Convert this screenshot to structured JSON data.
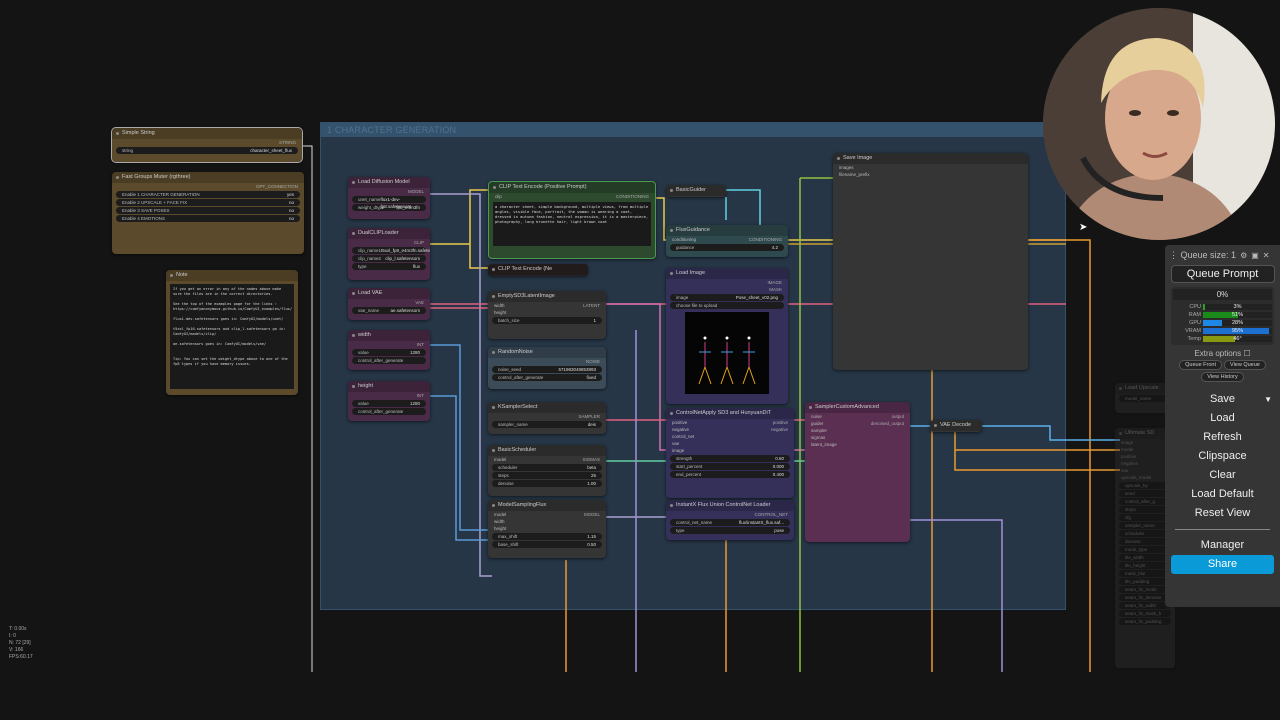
{
  "group": {
    "title": "1 CHARACTER GENERATION"
  },
  "nodes": {
    "simple_string": {
      "title": "Simple String",
      "outputs": [
        "STRING"
      ],
      "widgets": [
        {
          "name": "string",
          "value": "character_sheet_flux"
        }
      ]
    },
    "fast_groups_muter": {
      "title": "Fast Groups Muter (rgthree)",
      "outputs": [
        "OPT_CONNECTION"
      ],
      "widgets": [
        {
          "name": "Enable 1 CHARACTER GENERATION",
          "value": "yes"
        },
        {
          "name": "Enable 2 UPSCALE + FACE FIX",
          "value": "no"
        },
        {
          "name": "Enable 3 SAVE POSES",
          "value": "no"
        },
        {
          "name": "Enable 4 EMOTIONS",
          "value": "no"
        }
      ]
    },
    "note": {
      "title": "Note",
      "text": "If you get an error in any of the nodes above make sure the files are in the correct directories.\n\nSee the top of the examples page for the links :\nhttps://comfyanonymous.github.io/ComfyUI_examples/flux/\n\nflux1-dev.safetensors goes in: ComfyUI/models/unet/\n\nt5xxl_fp16.safetensors and clip_l.safetensors go in: ComfyUI/models/clip/\n\nae.safetensors goes in: ComfyUI/models/vae/\n\n\nTip: You can set the weight_dtype above to one of the fp8 types if you have memory issues."
    },
    "load_diffusion_model": {
      "title": "Load Diffusion Model",
      "outputs": [
        "MODEL"
      ],
      "widgets": [
        {
          "name": "unet_name",
          "value": "flux1-dev-fp8.safetensors"
        },
        {
          "name": "weight_dtype",
          "value": "fp8_e4m3fn"
        }
      ]
    },
    "dual_clip_loader": {
      "title": "DualCLIPLoader",
      "outputs": [
        "CLIP"
      ],
      "widgets": [
        {
          "name": "clip_name1",
          "value": "t5xxl_fp8_e4m3fn.safetensors"
        },
        {
          "name": "clip_name2",
          "value": "clip_l.safetensors"
        },
        {
          "name": "type",
          "value": "flux"
        }
      ]
    },
    "load_vae": {
      "title": "Load VAE",
      "outputs": [
        "VAE"
      ],
      "widgets": [
        {
          "name": "vae_name",
          "value": "ae.safetensors"
        }
      ]
    },
    "width": {
      "title": "width",
      "outputs": [
        "INT"
      ],
      "widgets": [
        {
          "name": "value",
          "value": "1280"
        },
        {
          "name": "control_after_generate",
          "value": ""
        }
      ]
    },
    "height": {
      "title": "height",
      "outputs": [
        "INT"
      ],
      "widgets": [
        {
          "name": "value",
          "value": "1280"
        },
        {
          "name": "control_after_generate",
          "value": ""
        }
      ]
    },
    "clip_positive": {
      "title": "CLIP Text Encode (Positive Prompt)",
      "inputs": [
        "clip"
      ],
      "outputs": [
        "CONDITIONING"
      ],
      "prompt": "a character sheet, simple background, multiple views, from multiple angles, visible face, portrait, the woman is wearing a coat, dressed in autumn fashion, neutral expression, it is a masterpiece, photography, long brunette hair, light brown coat"
    },
    "clip_negative": {
      "title": "CLIP Text Encode (Ne"
    },
    "empty_latent": {
      "title": "EmptySD3LatentImage",
      "inputs": [
        "width",
        "height"
      ],
      "outputs": [
        "LATENT"
      ],
      "widgets": [
        {
          "name": "batch_size",
          "value": "1"
        }
      ]
    },
    "random_noise": {
      "title": "RandomNoise",
      "outputs": [
        "NOISE"
      ],
      "widgets": [
        {
          "name": "noise_seed",
          "value": "571983048853893"
        },
        {
          "name": "control_after_generate",
          "value": "fixed"
        }
      ]
    },
    "ksampler_select": {
      "title": "KSamplerSelect",
      "outputs": [
        "SAMPLER"
      ],
      "widgets": [
        {
          "name": "sampler_name",
          "value": "deis"
        }
      ]
    },
    "basic_scheduler": {
      "title": "BasicScheduler",
      "inputs": [
        "model"
      ],
      "outputs": [
        "SIGMAS"
      ],
      "widgets": [
        {
          "name": "scheduler",
          "value": "beta"
        },
        {
          "name": "steps",
          "value": "25"
        },
        {
          "name": "denoise",
          "value": "1.00"
        }
      ]
    },
    "model_sampling_flux": {
      "title": "ModelSamplingFlux",
      "inputs": [
        "model",
        "width",
        "height"
      ],
      "outputs": [
        "MODEL"
      ],
      "widgets": [
        {
          "name": "max_shift",
          "value": "1.15"
        },
        {
          "name": "base_shift",
          "value": "0.50"
        }
      ]
    },
    "basic_guider": {
      "title": "BasicGuider"
    },
    "flux_guidance": {
      "title": "FluxGuidance",
      "inputs": [
        "conditioning"
      ],
      "outputs": [
        "CONDITIONING"
      ],
      "widgets": [
        {
          "name": "guidance",
          "value": "4.2"
        }
      ]
    },
    "load_image": {
      "title": "Load Image",
      "outputs": [
        "IMAGE",
        "MASK"
      ],
      "widgets": [
        {
          "name": "image",
          "value": "Pose_sheet_v02.png"
        }
      ],
      "upload_label": "choose file to upload"
    },
    "controlnet_apply": {
      "title": "ControlNetApply SD3 and HunyuanDiT",
      "inputs": [
        "positive",
        "negative",
        "control_net",
        "vae",
        "image"
      ],
      "outputs": [
        "positive",
        "negative"
      ],
      "widgets": [
        {
          "name": "strength",
          "value": "0.60"
        },
        {
          "name": "start_percent",
          "value": "0.000"
        },
        {
          "name": "end_percent",
          "value": "0.400"
        }
      ]
    },
    "controlnet_loader": {
      "title": "InstantX Flux Union ControlNet Loader",
      "outputs": [
        "CONTROL_NET"
      ],
      "widgets": [
        {
          "name": "control_net_name",
          "value": "flux\\instantX_flux.saf..."
        },
        {
          "name": "type",
          "value": "pose"
        }
      ]
    },
    "sampler_custom_advanced": {
      "title": "SamplerCustomAdvanced",
      "inputs": [
        "noise",
        "guider",
        "sampler",
        "sigmas",
        "latent_image"
      ],
      "outputs": [
        "output",
        "denoised_output"
      ]
    },
    "vae_decode": {
      "title": "VAE Decode"
    },
    "save_image": {
      "title": "Save Image",
      "inputs": [
        "images",
        "filename_prefix"
      ]
    },
    "load_upscale": {
      "title": "Load Upscale",
      "widgets": [
        {
          "name": "model_name",
          "value": ""
        }
      ]
    },
    "ultimate_sd": {
      "title": "Ultimate SD",
      "inputs": [
        "image",
        "model",
        "positive",
        "negative",
        "vae",
        "upscale_model"
      ],
      "widgets": [
        {
          "name": "upscale_by",
          "value": ""
        },
        {
          "name": "seed",
          "value": ""
        },
        {
          "name": "control_after_g",
          "value": ""
        },
        {
          "name": "steps",
          "value": ""
        },
        {
          "name": "cfg",
          "value": ""
        },
        {
          "name": "sampler_name",
          "value": ""
        },
        {
          "name": "scheduler",
          "value": ""
        },
        {
          "name": "denoise",
          "value": ""
        },
        {
          "name": "mode_type",
          "value": ""
        },
        {
          "name": "tile_width",
          "value": ""
        },
        {
          "name": "tile_height",
          "value": ""
        },
        {
          "name": "mask_blur",
          "value": ""
        },
        {
          "name": "tile_padding",
          "value": ""
        },
        {
          "name": "seam_fix_mode",
          "value": ""
        },
        {
          "name": "seam_fix_denoise",
          "value": ""
        },
        {
          "name": "seam_fix_width",
          "value": ""
        },
        {
          "name": "seam_fix_mask_b",
          "value": ""
        },
        {
          "name": "seam_fix_padding",
          "value": ""
        }
      ]
    }
  },
  "panel": {
    "queue_size": "Queue size: 1",
    "queue_prompt": "Queue Prompt",
    "progress": "0%",
    "stats": [
      {
        "label": "CPU",
        "value": "3%",
        "percent": 3,
        "color": "#2aa02a"
      },
      {
        "label": "RAM",
        "value": "51%",
        "percent": 51,
        "color": "#1a8a1a"
      },
      {
        "label": "GPU",
        "value": "28%",
        "percent": 28,
        "color": "#1e88e5"
      },
      {
        "label": "VRAM",
        "value": "95%",
        "percent": 95,
        "color": "#1e70d0"
      },
      {
        "label": "Temp",
        "value": "46°",
        "percent": 46,
        "color": "#8a9a10"
      }
    ],
    "extra_options": "Extra options",
    "queue_front": "Queue Front",
    "view_queue": "View Queue",
    "view_history": "View History",
    "save": "Save",
    "load": "Load",
    "refresh": "Refresh",
    "clipspace": "Clipspace",
    "clear": "Clear",
    "load_default": "Load Default",
    "reset_view": "Reset View",
    "manager": "Manager",
    "share": "Share"
  },
  "corner_stats": {
    "t": "T: 0.00s",
    "i": "I: 0",
    "n": "N: 72 [29]",
    "v": "V: 166",
    "fps": "FPS:60.17"
  },
  "colors": {
    "accent": "#0b9ad8",
    "group": "#263646",
    "clip_wire": "#e8c84a",
    "model_wire": "#b080c0",
    "vae_wire": "#e06080",
    "int_wire": "#5a9ad8",
    "cond_wire": "#e89a30"
  }
}
